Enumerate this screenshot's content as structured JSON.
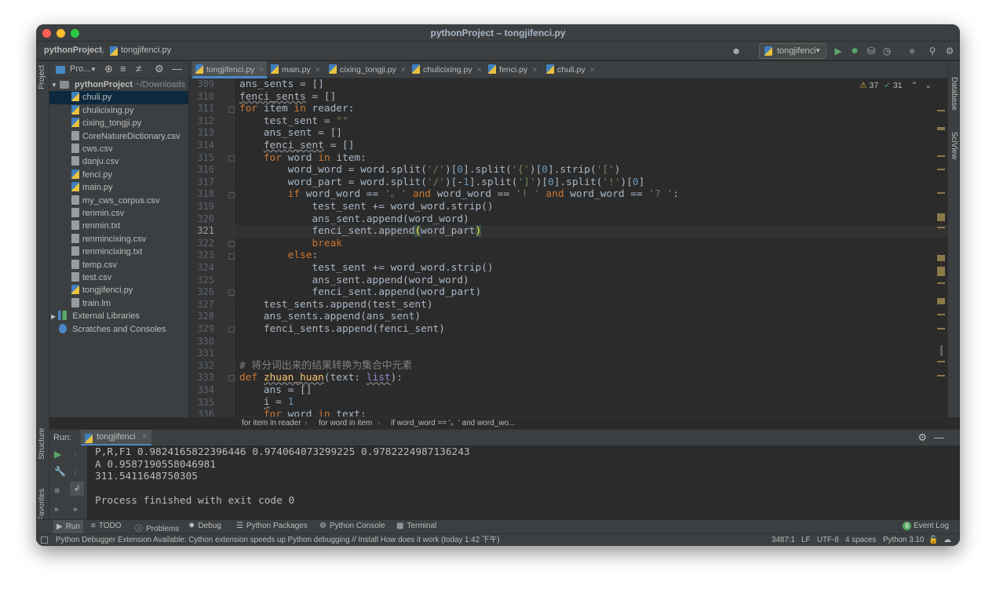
{
  "window": {
    "title": "pythonProject – tongjifenci.py"
  },
  "nav": {
    "project": "pythonProject",
    "file": "tongjifenci.py"
  },
  "run_config": {
    "name": "tongjifenci"
  },
  "sidebar": {
    "project_label": "Project",
    "structure_label": "Structure",
    "favorites_label": "Favorites"
  },
  "right_sidebar": {
    "database_label": "Database",
    "sciview_label": "SciView"
  },
  "project_panel": {
    "title": "Pro...",
    "root": "pythonProject",
    "root_path": "~/Downloads",
    "files": [
      {
        "name": "chuli.py",
        "type": "py"
      },
      {
        "name": "chulicixing.py",
        "type": "py"
      },
      {
        "name": "cixing_tongji.py",
        "type": "py"
      },
      {
        "name": "CoreNatureDictionary.csv",
        "type": "txt"
      },
      {
        "name": "cws.csv",
        "type": "txt"
      },
      {
        "name": "danju.csv",
        "type": "txt"
      },
      {
        "name": "fenci.py",
        "type": "py"
      },
      {
        "name": "main.py",
        "type": "py"
      },
      {
        "name": "my_cws_corpus.csv",
        "type": "txt"
      },
      {
        "name": "renmin.csv",
        "type": "txt"
      },
      {
        "name": "renmin.txt",
        "type": "txt"
      },
      {
        "name": "renmincixing.csv",
        "type": "txt"
      },
      {
        "name": "renmincixing.txt",
        "type": "txt"
      },
      {
        "name": "temp.csv",
        "type": "txt"
      },
      {
        "name": "test.csv",
        "type": "txt"
      },
      {
        "name": "tongjifenci.py",
        "type": "py"
      },
      {
        "name": "train.lm",
        "type": "txt"
      }
    ],
    "external": "External Libraries",
    "scratches": "Scratches and Consoles"
  },
  "tabs": [
    "tongjifenci.py",
    "main.py",
    "cixing_tongji.py",
    "chulicixing.py",
    "fenci.py",
    "chuli.py"
  ],
  "inspections": {
    "warnings": "37",
    "ok": "31"
  },
  "editor": {
    "current_line": "321",
    "line_numbers": [
      "309",
      "310",
      "311",
      "312",
      "313",
      "314",
      "315",
      "316",
      "317",
      "318",
      "319",
      "320",
      "321",
      "322",
      "323",
      "324",
      "325",
      "326",
      "327",
      "328",
      "329",
      "330",
      "331",
      "332",
      "333",
      "334",
      "335",
      "336"
    ],
    "comment_text": "# 将分词出来的结果转换为集合中元素"
  },
  "breadcrumbs": [
    "for item in reader",
    "for word in item",
    "if word_word == '。' and word_wo..."
  ],
  "run": {
    "label": "Run:",
    "tab": "tongjifenci",
    "output": [
      "P,R,F1 0.9824165822396446 0.974064073299225 0.9782224987136243",
      "A 0.9587190558046981",
      "311.5411648750305",
      "",
      "Process finished with exit code 0"
    ]
  },
  "bottom_tabs": [
    "Run",
    "TODO",
    "Problems",
    "Debug",
    "Python Packages",
    "Python Console",
    "Terminal"
  ],
  "event_log": {
    "label": "Event Log",
    "count": "6"
  },
  "status": {
    "message": "Python Debugger Extension Available: Cython extension speeds up Python debugging // Install   How does it work (today 1:42 下午)",
    "position": "3487:1",
    "line_sep": "LF",
    "encoding": "UTF-8",
    "indent": "4 spaces",
    "interpreter": "Python 3.10"
  },
  "colors": {
    "bg": "#2b2b2b",
    "panel": "#3c3f41",
    "keyword": "#cc7832",
    "string": "#6a8759",
    "number": "#6897bb",
    "run_green": "#59a869"
  }
}
